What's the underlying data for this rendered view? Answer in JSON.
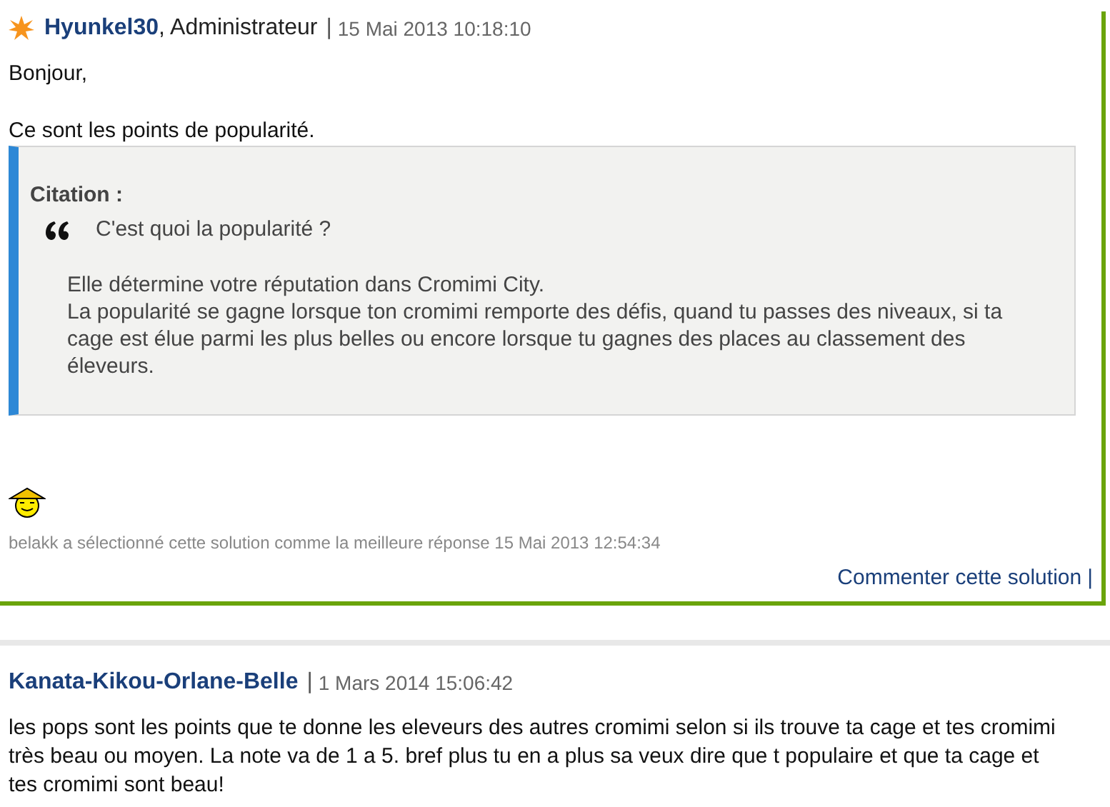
{
  "posts": [
    {
      "author": "Hyunkel30",
      "role": ", Administrateur",
      "separator": "|",
      "date": "15 Mai 2013 10:18:10",
      "starred": true,
      "best": true,
      "paragraphs": [
        "Bonjour,",
        "Ce sont les points de popularité."
      ],
      "quote": {
        "label": "Citation :",
        "question": "C'est quoi la popularité ?",
        "lines": [
          "Elle détermine votre réputation dans Cromimi City.",
          "La popularité se gagne lorsque ton cromimi remporte des défis, quand tu passes des niveaux, si ta cage est élue parmi les plus belles ou encore lorsque tu gagnes des places au classement des éleveurs."
        ]
      },
      "smiley": true,
      "selection_note": "belakk a sélectionné cette solution comme la meilleure réponse 15 Mai 2013 12:54:34",
      "comment_link": "Commenter cette solution",
      "comment_separator": "|"
    },
    {
      "author": "Kanata-Kikou-Orlane-Belle",
      "separator": "|",
      "date": "1 Mars 2014 15:06:42",
      "starred": false,
      "best": false,
      "paragraphs": [
        "les pops sont les points que te donne les eleveurs des autres cromimi selon si ils trouve ta cage et tes cromimi très beau ou moyen. La note va de 1 a 5. bref plus tu en a plus sa veux dire que t populaire et que ta cage et tes cromimi sont beau!"
      ]
    }
  ]
}
